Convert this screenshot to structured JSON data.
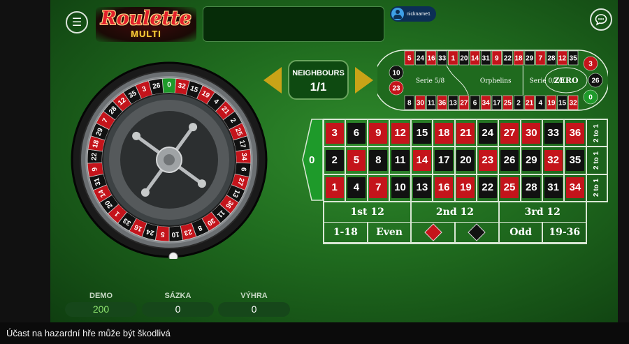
{
  "game": {
    "logo_main": "Roulette",
    "logo_sub": "MULTI",
    "username": "nickname1"
  },
  "icons": {
    "menu": "hamburger-menu-icon",
    "chat": "chat-bubble-icon",
    "user": "user-avatar-icon"
  },
  "neighbours": {
    "label": "NEIGHBOURS",
    "value": "1/1"
  },
  "wheel": {
    "sequence": [
      0,
      32,
      15,
      19,
      4,
      21,
      2,
      25,
      17,
      34,
      6,
      27,
      13,
      36,
      11,
      30,
      8,
      23,
      10,
      5,
      24,
      16,
      33,
      1,
      20,
      14,
      31,
      9,
      22,
      18,
      29,
      7,
      28,
      12,
      35,
      3,
      26
    ]
  },
  "racetrack": {
    "top_row": [
      5,
      24,
      16,
      33,
      1,
      20,
      14,
      31,
      9,
      22,
      18,
      29,
      7,
      28,
      12,
      35
    ],
    "bottom_row": [
      8,
      30,
      11,
      36,
      13,
      27,
      6,
      34,
      17,
      25,
      2,
      21,
      4,
      19,
      15,
      32
    ],
    "left_end": [
      10,
      23
    ],
    "right_end": [
      3,
      26,
      0
    ],
    "sections": [
      "Serie 5/8",
      "Orphelins",
      "Serie 0/2/3",
      "ZERO"
    ]
  },
  "board": {
    "zero": "0",
    "rows": [
      [
        3,
        6,
        9,
        12,
        15,
        18,
        21,
        24,
        27,
        30,
        33,
        36
      ],
      [
        2,
        5,
        8,
        11,
        14,
        17,
        20,
        23,
        26,
        29,
        32,
        35
      ],
      [
        1,
        4,
        7,
        10,
        13,
        16,
        19,
        22,
        25,
        28,
        31,
        34
      ]
    ],
    "reds": [
      1,
      3,
      5,
      7,
      9,
      12,
      14,
      16,
      18,
      19,
      21,
      23,
      25,
      27,
      30,
      32,
      34,
      36
    ],
    "column_bets": [
      "2 to 1",
      "2 to 1",
      "2 to 1"
    ],
    "dozens": [
      "1st 12",
      "2nd 12",
      "3rd 12"
    ],
    "outside": [
      "1-18",
      "Even",
      "red",
      "black",
      "Odd",
      "19-36"
    ]
  },
  "colors": {
    "red": "#c4141b",
    "black": "#111111",
    "felt": "#1f6a1e",
    "gold": "#c9a317",
    "zero_green": "#1e9a2a"
  },
  "stats": {
    "demo_label": "DEMO",
    "demo_value": "200",
    "bet_label": "SÁZKA",
    "bet_value": "0",
    "win_label": "VÝHRA",
    "win_value": "0"
  },
  "footer": {
    "warning": "Účast na hazardní hře může být škodlivá"
  }
}
